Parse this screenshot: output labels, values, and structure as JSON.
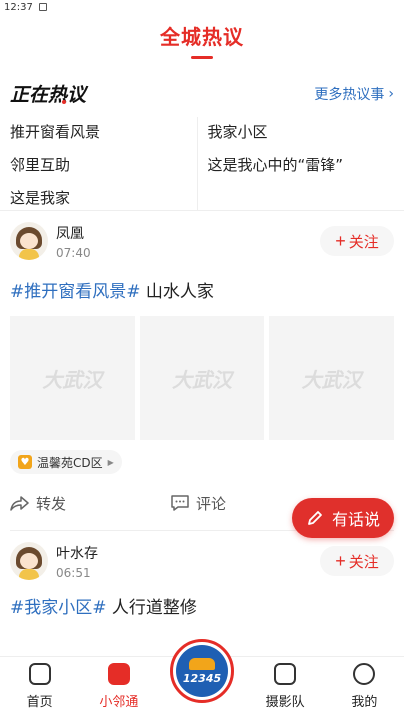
{
  "status": {
    "time": "12:37"
  },
  "header": {
    "title": "全城热议"
  },
  "hot": {
    "title": "正在热议",
    "more": "更多热议事",
    "left_topics": [
      "推开窗看风景",
      "邻里互助",
      "这是我家"
    ],
    "right_topics": [
      "我家小区",
      "这是我心中的“雷锋”"
    ]
  },
  "posts": [
    {
      "name": "凤凰",
      "time": "07:40",
      "follow": "关注",
      "tag": "#推开窗看风景#",
      "text": " 山水人家",
      "placeholder": "大武汉",
      "location": "温馨苑CD区",
      "share": "转发",
      "comment": "评论"
    },
    {
      "name": "叶水存",
      "time": "06:51",
      "follow": "关注",
      "tag": "#我家小区#",
      "text": " 人行道整修"
    }
  ],
  "fab": {
    "label": "有话说"
  },
  "nav": {
    "home": "首页",
    "neighbor": "小邻通",
    "center_num": "12345",
    "photo": "摄影队",
    "mine": "我的"
  },
  "colors": {
    "accent": "#e52d27",
    "link": "#2f6fbf"
  }
}
